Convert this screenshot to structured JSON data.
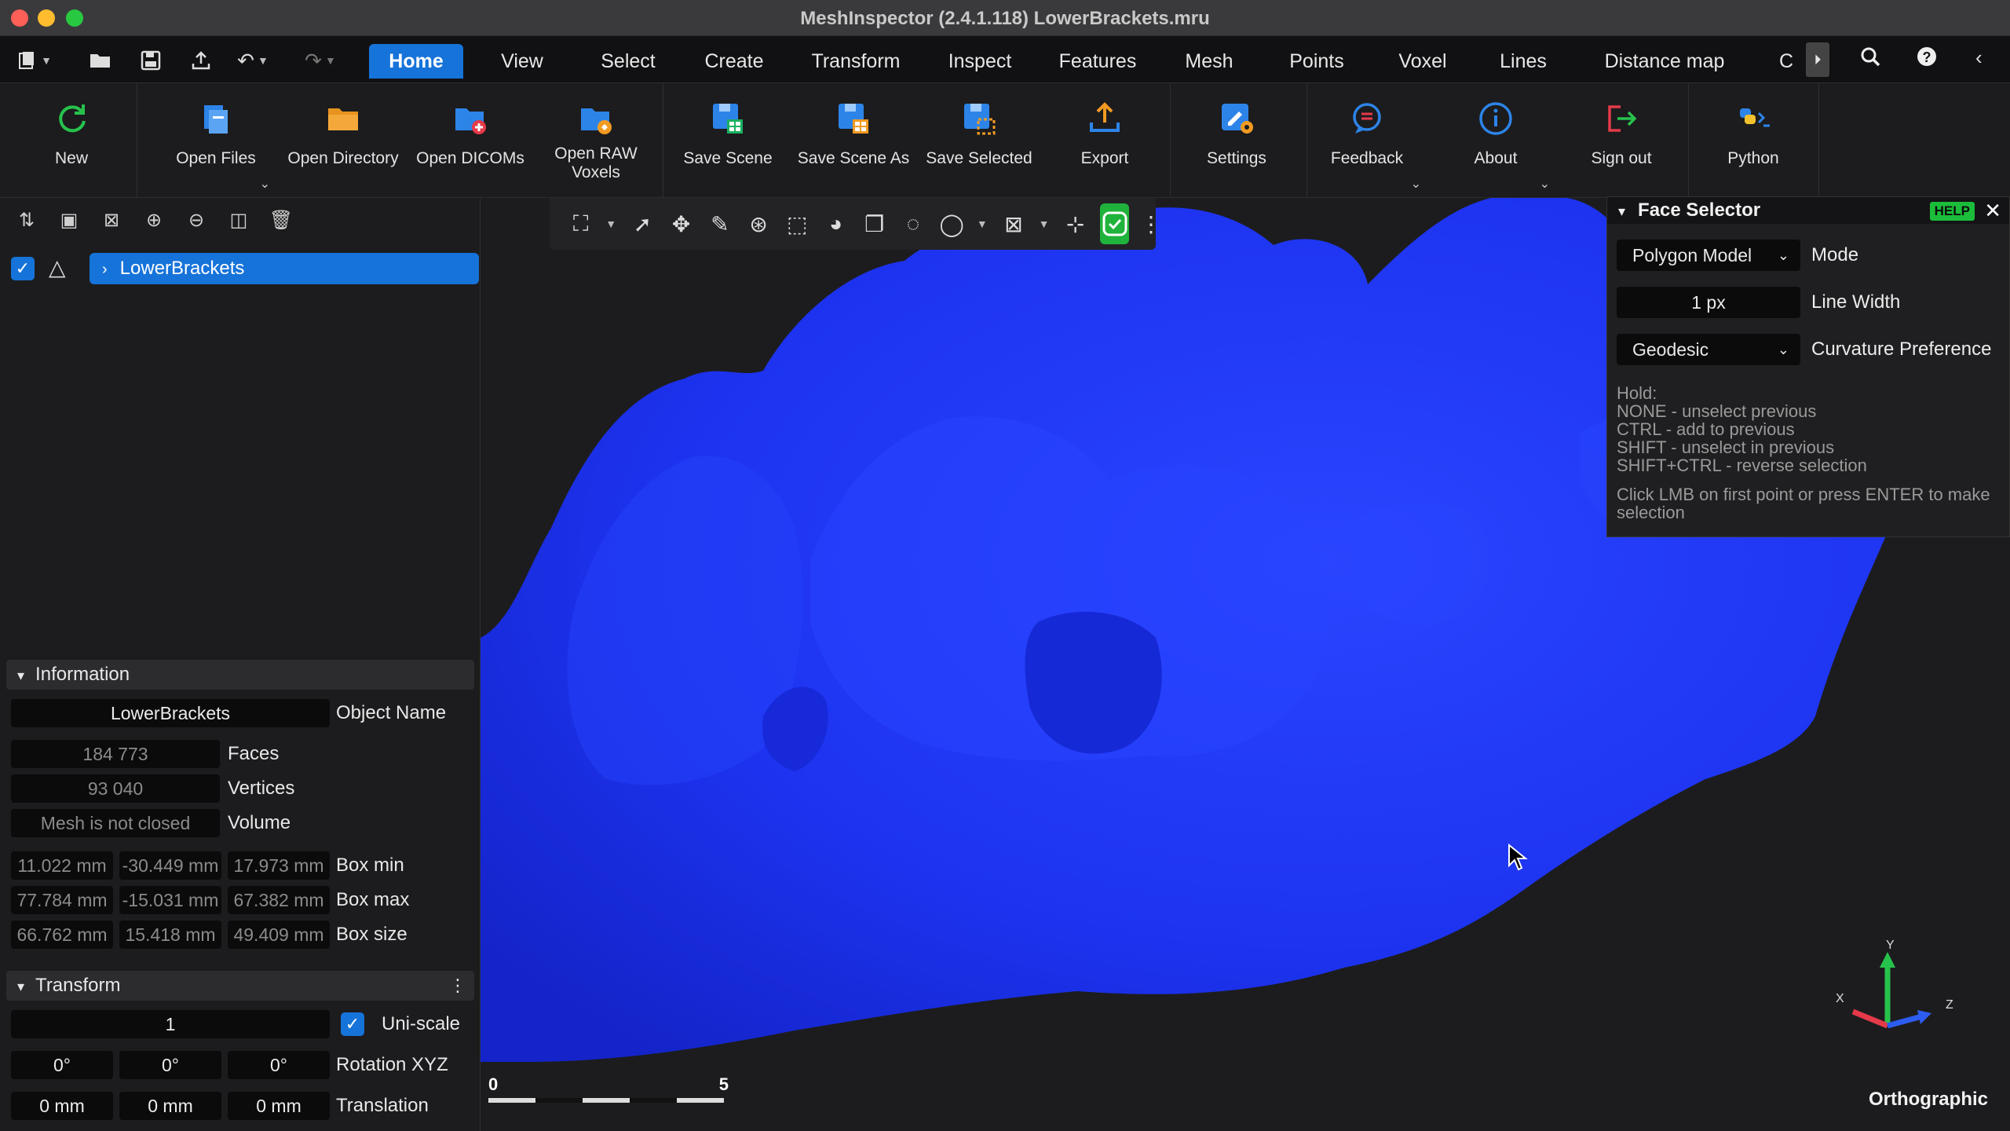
{
  "window": {
    "title": "MeshInspector (2.4.1.118) LowerBrackets.mru"
  },
  "menu": {
    "tabs": [
      "Home",
      "View",
      "Select",
      "Create",
      "Transform",
      "Inspect",
      "Features",
      "Mesh",
      "Points",
      "Voxel",
      "Lines",
      "Distance map",
      "C"
    ],
    "active_tab": "Home"
  },
  "ribbon": {
    "new": "New",
    "open_files": "Open Files",
    "open_directory": "Open Directory",
    "open_dicoms": "Open DICOMs",
    "open_raw_voxels_1": "Open RAW",
    "open_raw_voxels_2": "Voxels",
    "save_scene": "Save Scene",
    "save_scene_as": "Save Scene As",
    "save_selected": "Save Selected",
    "export": "Export",
    "settings": "Settings",
    "feedback": "Feedback",
    "about": "About",
    "sign_out": "Sign out",
    "python": "Python"
  },
  "scene_tree": {
    "object_name": "LowerBrackets",
    "checked": true
  },
  "information": {
    "header": "Information",
    "object_name_value": "LowerBrackets",
    "object_name_label": "Object Name",
    "faces_value": "184 773",
    "faces_label": "Faces",
    "vertices_value": "93 040",
    "vertices_label": "Vertices",
    "volume_value": "Mesh is not closed",
    "volume_label": "Volume",
    "box_min": [
      "11.022 mm",
      "-30.449 mm",
      "17.973 mm"
    ],
    "box_min_label": "Box min",
    "box_max": [
      "77.784 mm",
      "-15.031 mm",
      "67.382 mm"
    ],
    "box_max_label": "Box max",
    "box_size": [
      "66.762 mm",
      "15.418 mm",
      "49.409 mm"
    ],
    "box_size_label": "Box size"
  },
  "transform": {
    "header": "Transform",
    "scale_value": "1",
    "uniscale_label": "Uni-scale",
    "rotation": [
      "0°",
      "0°",
      "0°"
    ],
    "rotation_label": "Rotation XYZ",
    "translation": [
      "0 mm",
      "0 mm",
      "0 mm"
    ],
    "translation_label": "Translation"
  },
  "face_selector": {
    "title": "Face Selector",
    "help": "HELP",
    "mode_value": "Polygon Model",
    "mode_label": "Mode",
    "line_width_value": "1 px",
    "line_width_label": "Line Width",
    "curvature_value": "Geodesic",
    "curvature_label": "Curvature Preference",
    "help_lines": [
      "Hold:",
      "NONE - unselect previous",
      "CTRL - add to previous",
      "SHIFT - unselect in previous",
      "SHIFT+CTRL - reverse selection"
    ],
    "help_footer": "Click LMB on first point or press ENTER to make selection"
  },
  "viewport": {
    "projection": "Orthographic",
    "scale_start": "0",
    "scale_end": "5",
    "axes": {
      "x": "X",
      "y": "Y",
      "z": "Z"
    },
    "mesh_color": "#1f35f5"
  }
}
